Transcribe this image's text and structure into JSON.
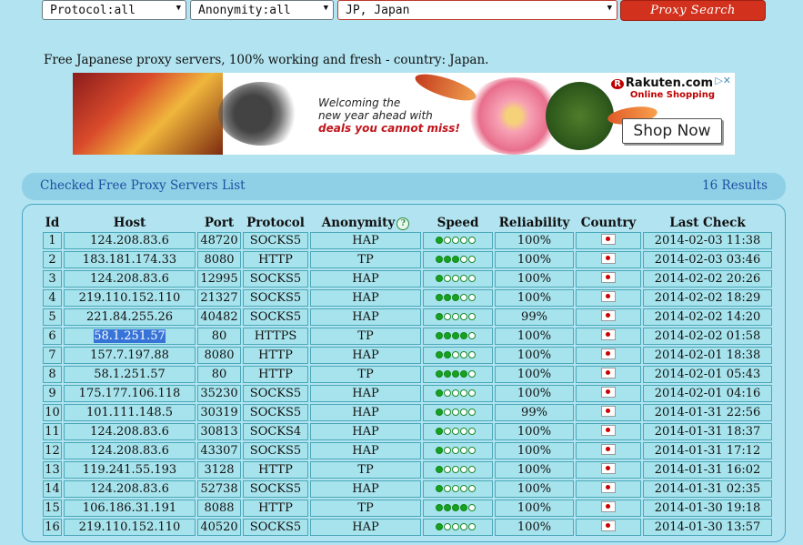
{
  "filters": {
    "protocol": "Protocol:all",
    "anonymity": "Anonymity:all",
    "country": "JP, Japan",
    "search_label": "Proxy Search"
  },
  "intro": "Free Japanese proxy servers, 100% working and fresh - country: Japan.",
  "ad": {
    "line1": "Welcoming the",
    "line2": "new year ahead with",
    "line3": "deals you cannot miss!",
    "brand": "Rakuten.com",
    "brand_sub": "Online Shopping",
    "cta": "Shop Now"
  },
  "list": {
    "title": "Checked Free Proxy Servers List",
    "count": "16 Results"
  },
  "columns": [
    "Id",
    "Host",
    "Port",
    "Protocol",
    "Anonymity",
    "Speed",
    "Reliability",
    "Country",
    "Last Check"
  ],
  "rows": [
    {
      "id": "1",
      "host": "124.208.83.6",
      "port": "48720",
      "protocol": "SOCKS5",
      "anonymity": "HAP",
      "speed": 1,
      "reliability": "100%",
      "last": "2014-02-03 11:38"
    },
    {
      "id": "2",
      "host": "183.181.174.33",
      "port": "8080",
      "protocol": "HTTP",
      "anonymity": "TP",
      "speed": 3,
      "reliability": "100%",
      "last": "2014-02-03 03:46"
    },
    {
      "id": "3",
      "host": "124.208.83.6",
      "port": "12995",
      "protocol": "SOCKS5",
      "anonymity": "HAP",
      "speed": 1,
      "reliability": "100%",
      "last": "2014-02-02 20:26"
    },
    {
      "id": "4",
      "host": "219.110.152.110",
      "port": "21327",
      "protocol": "SOCKS5",
      "anonymity": "HAP",
      "speed": 3,
      "reliability": "100%",
      "last": "2014-02-02 18:29"
    },
    {
      "id": "5",
      "host": "221.84.255.26",
      "port": "40482",
      "protocol": "SOCKS5",
      "anonymity": "HAP",
      "speed": 1,
      "reliability": "99%",
      "last": "2014-02-02 14:20"
    },
    {
      "id": "6",
      "host": "58.1.251.57",
      "port": "80",
      "protocol": "HTTPS",
      "anonymity": "TP",
      "speed": 4,
      "reliability": "100%",
      "last": "2014-02-02 01:58"
    },
    {
      "id": "7",
      "host": "157.7.197.88",
      "port": "8080",
      "protocol": "HTTP",
      "anonymity": "HAP",
      "speed": 2,
      "reliability": "100%",
      "last": "2014-02-01 18:38"
    },
    {
      "id": "8",
      "host": "58.1.251.57",
      "port": "80",
      "protocol": "HTTP",
      "anonymity": "TP",
      "speed": 4,
      "reliability": "100%",
      "last": "2014-02-01 05:43"
    },
    {
      "id": "9",
      "host": "175.177.106.118",
      "port": "35230",
      "protocol": "SOCKS5",
      "anonymity": "HAP",
      "speed": 1,
      "reliability": "100%",
      "last": "2014-02-01 04:16"
    },
    {
      "id": "10",
      "host": "101.111.148.5",
      "port": "30319",
      "protocol": "SOCKS5",
      "anonymity": "HAP",
      "speed": 1,
      "reliability": "99%",
      "last": "2014-01-31 22:56"
    },
    {
      "id": "11",
      "host": "124.208.83.6",
      "port": "30813",
      "protocol": "SOCKS4",
      "anonymity": "HAP",
      "speed": 1,
      "reliability": "100%",
      "last": "2014-01-31 18:37"
    },
    {
      "id": "12",
      "host": "124.208.83.6",
      "port": "43307",
      "protocol": "SOCKS5",
      "anonymity": "HAP",
      "speed": 1,
      "reliability": "100%",
      "last": "2014-01-31 17:12"
    },
    {
      "id": "13",
      "host": "119.241.55.193",
      "port": "3128",
      "protocol": "HTTP",
      "anonymity": "TP",
      "speed": 1,
      "reliability": "100%",
      "last": "2014-01-31 16:02"
    },
    {
      "id": "14",
      "host": "124.208.83.6",
      "port": "52738",
      "protocol": "SOCKS5",
      "anonymity": "HAP",
      "speed": 1,
      "reliability": "100%",
      "last": "2014-01-31 02:35"
    },
    {
      "id": "15",
      "host": "106.186.31.191",
      "port": "8088",
      "protocol": "HTTP",
      "anonymity": "TP",
      "speed": 4,
      "reliability": "100%",
      "last": "2014-01-30 19:18"
    },
    {
      "id": "16",
      "host": "219.110.152.110",
      "port": "40520",
      "protocol": "SOCKS5",
      "anonymity": "HAP",
      "speed": 1,
      "reliability": "100%",
      "last": "2014-01-30 13:57"
    }
  ],
  "speed_max": 5,
  "colors": {
    "page_bg": "#b1e3f0",
    "button": "#d2321d",
    "link": "#1e4fa0",
    "cell_bg": "#a7e3ec",
    "speed_on": "#16a21f",
    "selection": "#3874d8"
  },
  "icons": {
    "dropdown": "chevron-down-icon",
    "help": "question-mark-icon",
    "country": "japan-flag-icon"
  }
}
